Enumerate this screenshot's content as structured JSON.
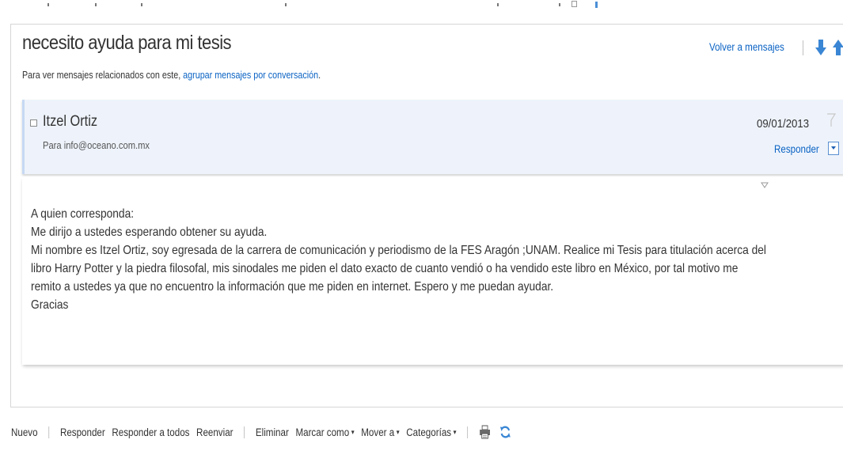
{
  "message": {
    "subject": "necesito ayuda para mi tesis",
    "hint_prefix": "Para ver mensajes relacionados con este, ",
    "hint_link": "agrupar mensajes por conversación",
    "hint_suffix": ".",
    "back_link": "Volver a mensajes",
    "sender": "Itzel Ortiz",
    "to_line": "Para info@oceano.com.mx",
    "date": "09/01/2013",
    "reply_label": "Responder",
    "body": [
      "A quien corresponda:",
      "Me dirijo a ustedes esperando obtener su ayuda.",
      "Mi nombre es Itzel Ortiz, soy egresada de la carrera de comunicación y periodismo de la FES Aragón ;UNAM. Realice mi Tesis para titulación acerca del",
      "libro Harry Potter y la piedra filosofal, mis sinodales me piden el dato exacto de cuanto vendió o ha vendido este libro en México, por tal motivo me",
      "remito a ustedes ya que no encuentro la información que me piden en internet. Espero y me puedan ayudar.",
      "Gracias"
    ]
  },
  "toolbar": {
    "new": "Nuevo",
    "reply": "Responder",
    "reply_all": "Responder a todos",
    "forward": "Reenviar",
    "delete": "Eliminar",
    "mark_as": "Marcar como",
    "move_to": "Mover a",
    "categories": "Categorías",
    "caret": "▾"
  },
  "icons": {
    "next": "down-arrow-icon",
    "previous": "up-arrow-icon",
    "flag": "flag-icon",
    "print": "printer-icon",
    "sync": "sync-icon"
  },
  "colors": {
    "link": "#0b63c4",
    "header_bg": "#eef3fb",
    "accent_blue": "#3a86d4"
  }
}
